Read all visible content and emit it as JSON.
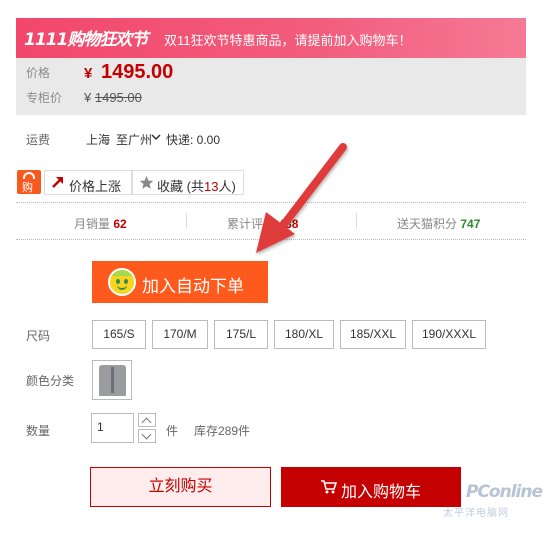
{
  "promo": {
    "logo_text": "1111购物狂欢节",
    "message": "双11狂欢节特惠商品，请提前加入购物车！"
  },
  "price": {
    "label": "价格",
    "currency": "¥",
    "value": "1495.00",
    "original_label": "专柜价",
    "original_currency": "¥",
    "original_value": "1495.00"
  },
  "shipping": {
    "label": "运费",
    "from": "上海",
    "to": "至广州",
    "fee": "快递: 0.00"
  },
  "actions": {
    "price_alert_label": "价格上涨",
    "favorite_label": "收藏",
    "favorite_prefix": "(共",
    "favorite_count": "13",
    "favorite_suffix": "人)"
  },
  "stats": {
    "monthly_sales_label": "月销量",
    "monthly_sales_value": "62",
    "reviews_label": "累计评价",
    "reviews_value": "488",
    "points_label": "送天猫积分",
    "points_value": "747"
  },
  "auto_order": {
    "label": "加入自动下单"
  },
  "size": {
    "label": "尺码",
    "options": [
      "165/S",
      "170/M",
      "175/L",
      "180/XL",
      "185/XXL",
      "190/XXXL"
    ]
  },
  "color": {
    "label": "颜色分类"
  },
  "quantity": {
    "label": "数量",
    "value": "1",
    "unit": "件",
    "stock": "库存289件"
  },
  "buttons": {
    "buy_now": "立刻购买",
    "add_to_cart": "加入购物车"
  },
  "watermark": {
    "brand": "PConline",
    "sub": "太平洋电脑网"
  },
  "colors": {
    "accent_red": "#c40000",
    "promo_pink": "#f2476b",
    "auto_order_orange": "#ff5a1e",
    "arrow_red": "#e03b3b",
    "points_green": "#2c8a2c"
  }
}
